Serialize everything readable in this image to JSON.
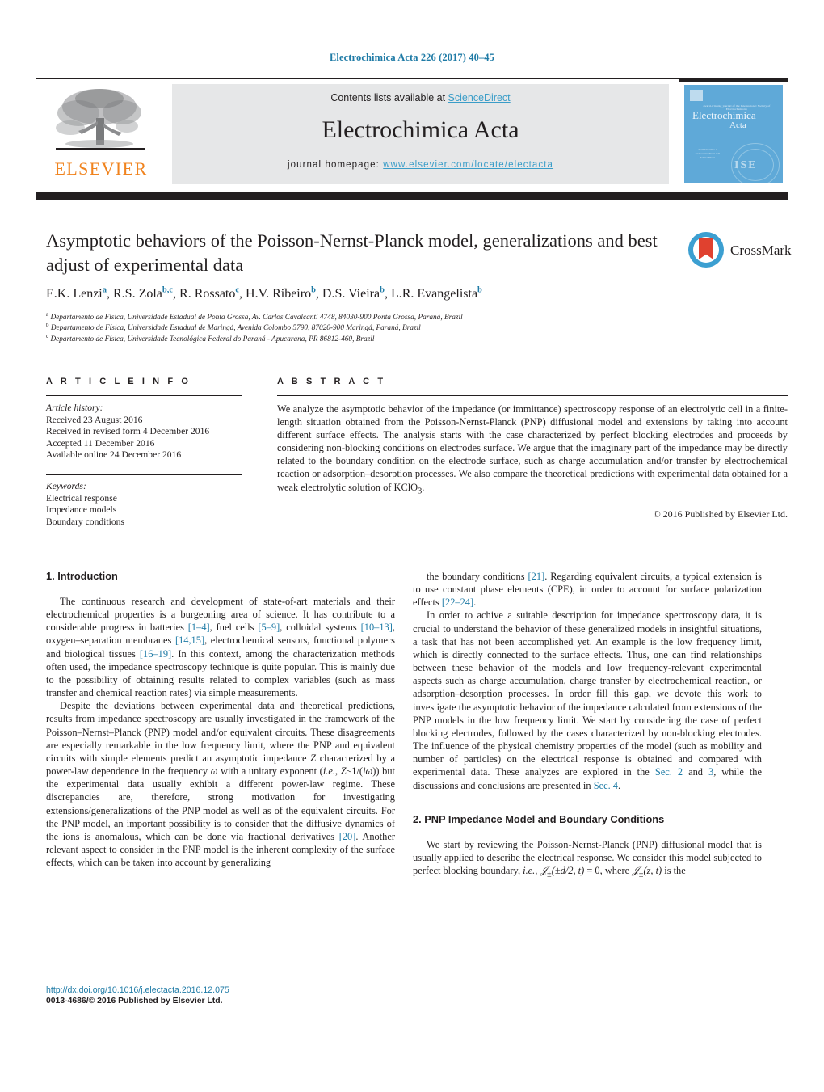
{
  "running_head": "Electrochimica Acta 226 (2017) 40–45",
  "masthead": {
    "contents_prefix": "Contents lists available at ",
    "sciencedirect": "ScienceDirect",
    "journal_name": "Electrochimica Acta",
    "homepage_prefix": "journal homepage: ",
    "homepage_url": "www.elsevier.com/locate/electacta",
    "publisher_logo_text": "ELSEVIER",
    "cover": {
      "tagline": "award-winning journal of the International Society of Electrochemistry",
      "title_line1": "Electrochimica",
      "title_line2": "Acta",
      "corner_note": "Available online at www.sciencedirect.com ScienceDirect",
      "seal_text": "ISE"
    }
  },
  "crossmark": {
    "label": "CrossMark"
  },
  "article": {
    "title": "Asymptotic behaviors of the Poisson-Nernst-Planck model, generalizations and best adjust of experimental data",
    "authors": [
      {
        "name": "E.K. Lenzi",
        "sup": "a"
      },
      {
        "name": "R.S. Zola",
        "sup": "b,c"
      },
      {
        "name": "R. Rossato",
        "sup": "c"
      },
      {
        "name": "H.V. Ribeiro",
        "sup": "b"
      },
      {
        "name": "D.S. Vieira",
        "sup": "b"
      },
      {
        "name": "L.R. Evangelista",
        "sup": "b"
      }
    ],
    "affiliations": [
      {
        "mark": "a",
        "text": "Departamento de Física, Universidade Estadual de Ponta Grossa, Av. Carlos Cavalcanti 4748, 84030-900 Ponta Grossa, Paraná, Brazil"
      },
      {
        "mark": "b",
        "text": "Departamento de Física, Universidade Estadual de Maringá, Avenida Colombo 5790, 87020-900 Maringá, Paraná, Brazil"
      },
      {
        "mark": "c",
        "text": "Departamento de Física, Universidade Tecnológica Federal do Paraná - Apucarana, PR 86812-460, Brazil"
      }
    ]
  },
  "info": {
    "heading": "A R T I C L E    I N F O",
    "history_label": "Article history:",
    "history": [
      "Received 23 August 2016",
      "Received in revised form 4 December 2016",
      "Accepted 11 December 2016",
      "Available online 24 December 2016"
    ],
    "keywords_label": "Keywords:",
    "keywords": [
      "Electrical response",
      "Impedance models",
      "Boundary conditions"
    ]
  },
  "abstract": {
    "heading": "A B S T R A C T",
    "body": "We analyze the asymptotic behavior of the impedance (or immittance) spectroscopy response of an electrolytic cell in a finite-length situation obtained from the Poisson-Nernst-Planck (PNP) diffusional model and extensions by taking into account different surface effects. The analysis starts with the case characterized by perfect blocking electrodes and proceeds by considering non-blocking conditions on electrodes surface. We argue that the imaginary part of the impedance may be directly related to the boundary condition on the electrode surface, such as charge accumulation and/or transfer by electrochemical reaction or adsorption–desorption processes. We also compare the theoretical predictions with experimental data obtained for a weak electrolytic solution of KClO",
    "body_sub": "3",
    "body_tail": ".",
    "copyright": "© 2016 Published by Elsevier Ltd."
  },
  "body": {
    "section1_heading": "1.  Introduction",
    "left_p1_a": "The continuous research and development of state-of-art materials and their electrochemical properties is a burgeoning area of science. It has contribute to a considerable progress in batteries ",
    "left_p1_r1": "[1–4]",
    "left_p1_b": ", fuel cells ",
    "left_p1_r2": "[5–9]",
    "left_p1_c": ", colloidal systems ",
    "left_p1_r3": "[10–13]",
    "left_p1_d": ", oxygen–separation membranes ",
    "left_p1_r4": "[14,15]",
    "left_p1_e": ", electrochemical sensors, functional polymers and biological tissues ",
    "left_p1_r5": "[16–19]",
    "left_p1_f": ". In this context, among the characterization methods often used, the impedance spectroscopy technique is quite popular. This is mainly due to the possibility of obtaining results related to complex variables (such as mass transfer and chemical reaction rates) via simple measurements.",
    "left_p2_a": "Despite the deviations between experimental data and theoretical predictions, results from impedance spectroscopy are usually investigated in the framework of the Poisson–Nernst–Planck (PNP) model and/or equivalent circuits. These disagreements are especially remarkable in the low frequency limit, where the PNP and equivalent circuits with simple elements predict an asymptotic impedance ",
    "left_p2_z1": "Z",
    "left_p2_b": " characterized by a power-law dependence in the frequency ",
    "left_p2_w": "ω",
    "left_p2_c": " with a unitary exponent (",
    "left_p2_ie": "i.e.",
    "left_p2_d": ", ",
    "left_p2_z2": "Z",
    "left_p2_e": "~1/(",
    "left_p2_iw": "iω",
    "left_p2_f": ")) but the experimental data usually exhibit a different power-law regime. These discrepancies are, therefore, strong motivation for investigating extensions/generalizations of the PNP model as well as of the equivalent circuits. For the PNP model, an important possibility is to consider that the diffusive dynamics of the ions is anomalous, which can be done via fractional derivatives ",
    "left_p2_r1": "[20]",
    "left_p2_g": ". Another relevant aspect to consider in the PNP model is the inherent complexity of the surface effects, which can be taken into account by generalizing",
    "right_p1_a": "the boundary conditions ",
    "right_p1_r1": "[21]",
    "right_p1_b": ". Regarding equivalent circuits, a typical extension is to use constant phase elements (CPE), in order to account for surface polarization effects ",
    "right_p1_r2": "[22–24]",
    "right_p1_c": ".",
    "right_p2_a": "In order to achive a suitable description for impedance spectroscopy data, it is crucial to understand the behavior of these generalized models in insightful situations, a task that has not been accomplished yet. An example is the low frequency limit, which is directly connected to the surface effects. Thus, one can find relationships between these behavior of the models and low frequency-relevant experimental aspects such as charge accumulation, charge transfer by electrochemical reaction, or adsorption–desorption processes. In order fill this gap, we devote this work to investigate the asymptotic behavior of the impedance calculated from extensions of the PNP models in the low frequency limit. We start by considering the case of perfect blocking electrodes, followed by the cases characterized by non-blocking electrodes. The influence of the physical chemistry properties of the model (such as mobility and number of particles) on the electrical response is obtained and compared with experimental data. These analyzes are explored in the ",
    "right_p2_s1": "Sec. 2",
    "right_p2_b": " and ",
    "right_p2_s2": "3",
    "right_p2_c": ", while the discussions and conclusions are presented in ",
    "right_p2_s3": "Sec. 4",
    "right_p2_d": ".",
    "section2_heading": "2.  PNP Impedance Model and Boundary Conditions",
    "right_p3_a": "We start by reviewing the Poisson-Nernst-Planck (PNP) diffusional model that is usually applied to describe the electrical response. We consider this model subjected to perfect blocking boundary, ",
    "right_p3_ie": "i.e.",
    "right_p3_b": ", ",
    "right_p3_m1": "𝒥",
    "right_p3_m1s": "±",
    "right_p3_m2": "(±d/2, t)",
    "right_p3_m3": " = 0, where ",
    "right_p3_m4": "𝒥",
    "right_p3_m4s": "±",
    "right_p3_m5": "(z, t)",
    "right_p3_c": " is the"
  },
  "footer": {
    "doi": "http://dx.doi.org/10.1016/j.electacta.2016.12.075",
    "issn": "0013-4686/© 2016 Published by Elsevier Ltd."
  },
  "colors": {
    "link": "#1f7ba6",
    "sciencedirect": "#3a9dc8",
    "elsevier_orange": "#f0831e",
    "dark": "#231f20",
    "band": "#e6e7e8",
    "cover_blue": "#5fa9d8",
    "crossmark_blue": "#3c9fd1",
    "crossmark_red": "#e0412f"
  }
}
